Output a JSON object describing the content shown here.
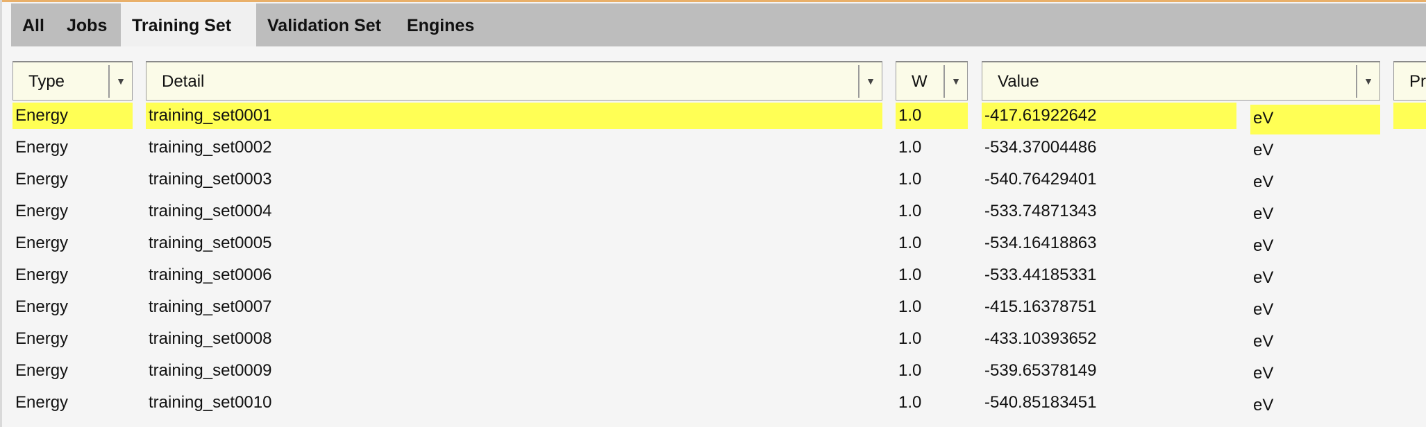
{
  "tabs": [
    {
      "label": "All",
      "active": false
    },
    {
      "label": "Jobs",
      "active": false
    },
    {
      "label": "Training Set",
      "active": true
    },
    {
      "label": "Validation Set",
      "active": false
    },
    {
      "label": "Engines",
      "active": false
    }
  ],
  "columns": {
    "type": "Type",
    "detail": "Detail",
    "weight": "W",
    "value": "Value",
    "extra": "Pr"
  },
  "dropdown_icon": "▼",
  "selected_row": 0,
  "highlight_color": "#ffff55",
  "rows": [
    {
      "type": "Energy",
      "detail": "training_set0001",
      "weight": "1.0",
      "value": "-417.61922642",
      "unit": "eV"
    },
    {
      "type": "Energy",
      "detail": "training_set0002",
      "weight": "1.0",
      "value": "-534.37004486",
      "unit": "eV"
    },
    {
      "type": "Energy",
      "detail": "training_set0003",
      "weight": "1.0",
      "value": "-540.76429401",
      "unit": "eV"
    },
    {
      "type": "Energy",
      "detail": "training_set0004",
      "weight": "1.0",
      "value": "-533.74871343",
      "unit": "eV"
    },
    {
      "type": "Energy",
      "detail": "training_set0005",
      "weight": "1.0",
      "value": "-534.16418863",
      "unit": "eV"
    },
    {
      "type": "Energy",
      "detail": "training_set0006",
      "weight": "1.0",
      "value": "-533.44185331",
      "unit": "eV"
    },
    {
      "type": "Energy",
      "detail": "training_set0007",
      "weight": "1.0",
      "value": "-415.16378751",
      "unit": "eV"
    },
    {
      "type": "Energy",
      "detail": "training_set0008",
      "weight": "1.0",
      "value": "-433.10393652",
      "unit": "eV"
    },
    {
      "type": "Energy",
      "detail": "training_set0009",
      "weight": "1.0",
      "value": "-539.65378149",
      "unit": "eV"
    },
    {
      "type": "Energy",
      "detail": "training_set0010",
      "weight": "1.0",
      "value": "-540.85183451",
      "unit": "eV"
    }
  ]
}
